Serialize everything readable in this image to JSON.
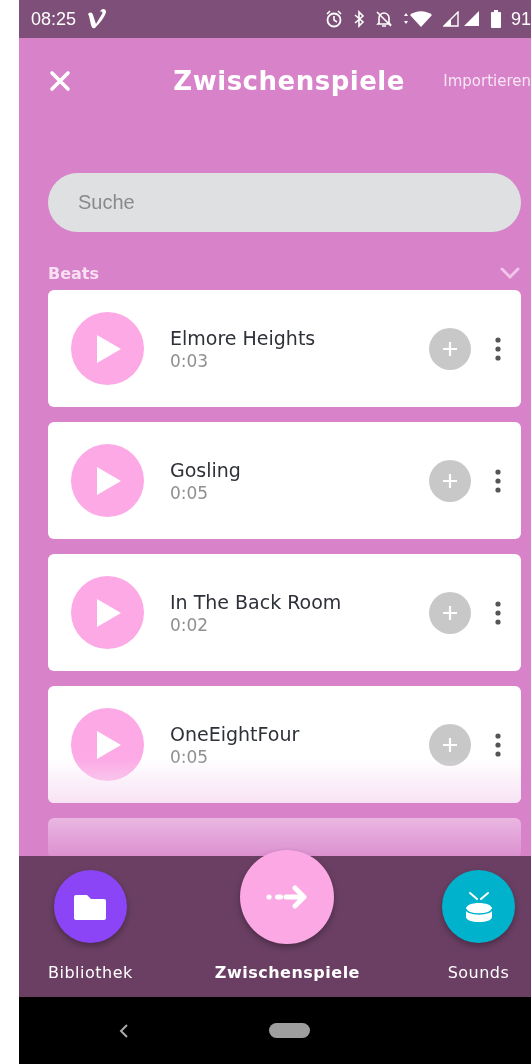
{
  "status_bar": {
    "time": "08:25",
    "battery": "91"
  },
  "header": {
    "title": "Zwischenspiele",
    "action": "Importieren"
  },
  "search": {
    "placeholder": "Suche"
  },
  "section": {
    "title": "Beats",
    "expanded": true
  },
  "tracks": [
    {
      "title": "Elmore Heights",
      "duration": "0:03"
    },
    {
      "title": "Gosling",
      "duration": "0:05"
    },
    {
      "title": "In The Back Room",
      "duration": "0:02"
    },
    {
      "title": "OneEightFour",
      "duration": "0:05"
    }
  ],
  "nav": [
    {
      "label": "Bibliothek",
      "selected": false,
      "color": "#8b45f7",
      "kind": "folder"
    },
    {
      "label": "Zwischenspiele",
      "selected": true,
      "color": "#fba8e4",
      "kind": "arrow"
    },
    {
      "label": "Sounds",
      "selected": false,
      "color": "#00b2cc",
      "kind": "drum"
    }
  ]
}
